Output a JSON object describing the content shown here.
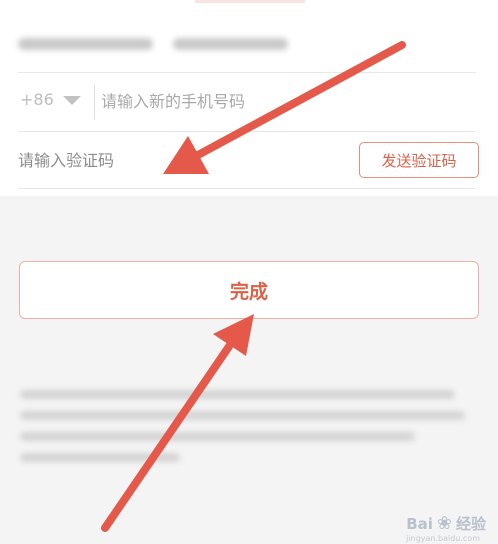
{
  "form": {
    "country_code": "+86",
    "phone_placeholder": "请输入新的手机号码",
    "code_placeholder": "请输入验证码",
    "send_code_label": "发送验证码"
  },
  "actions": {
    "done_label": "完成"
  },
  "watermark": {
    "brand_prefix": "Bai",
    "brand_suffix": "经验",
    "domain": "jingyan.baidu.com"
  },
  "colors": {
    "accent": "#d9624a",
    "arrow": "#e4594a",
    "background": "#f4f4f4"
  },
  "icons": {
    "country_dropdown": "chevron-down-icon",
    "annotation": "red-arrow-icon",
    "watermark_logo": "paw-icon"
  }
}
